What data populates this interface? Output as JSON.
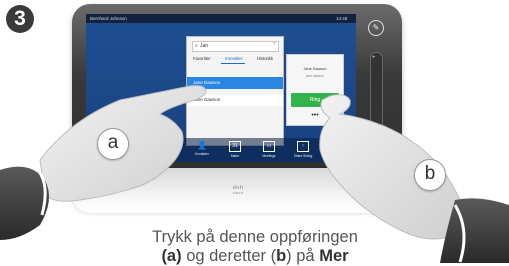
{
  "step_number": "3",
  "device": {
    "status_user": "Bernhard Johnson",
    "status_time": "14:48",
    "logo_text": "cisco"
  },
  "phonebook": {
    "search_value": "Jan",
    "tabs": [
      {
        "label": "Favoritter"
      },
      {
        "label": "Kontakter"
      },
      {
        "label": "Historikk"
      }
    ],
    "rows": [
      {
        "label": "Jane Dawson"
      },
      {
        "label": "Jane Dawson"
      }
    ]
  },
  "contact_card": {
    "name": "Jane Dawson",
    "subtitle": "jane.dawson",
    "call_label": "Ring",
    "more_label": "•••"
  },
  "app_bar": {
    "items": [
      {
        "label": "Kontakter",
        "icon": "person-icon"
      },
      {
        "label": "Møter",
        "icon": "calendar-icon"
      },
      {
        "label": "Meetings",
        "icon": "video-icon"
      },
      {
        "label": "Share Seting",
        "icon": "share-icon"
      }
    ]
  },
  "callouts": {
    "a": "a",
    "b": "b"
  },
  "caption": {
    "line1": "Trykk på denne oppføringen",
    "line2_pre": "(a)",
    "line2_mid": " og deretter (",
    "line2_b": "b",
    "line2_post": ") på ",
    "line2_end": "Mer"
  },
  "colors": {
    "screen_blue": "#1f4f93",
    "highlight_blue": "#2a86e0",
    "call_green": "#34b34a"
  }
}
